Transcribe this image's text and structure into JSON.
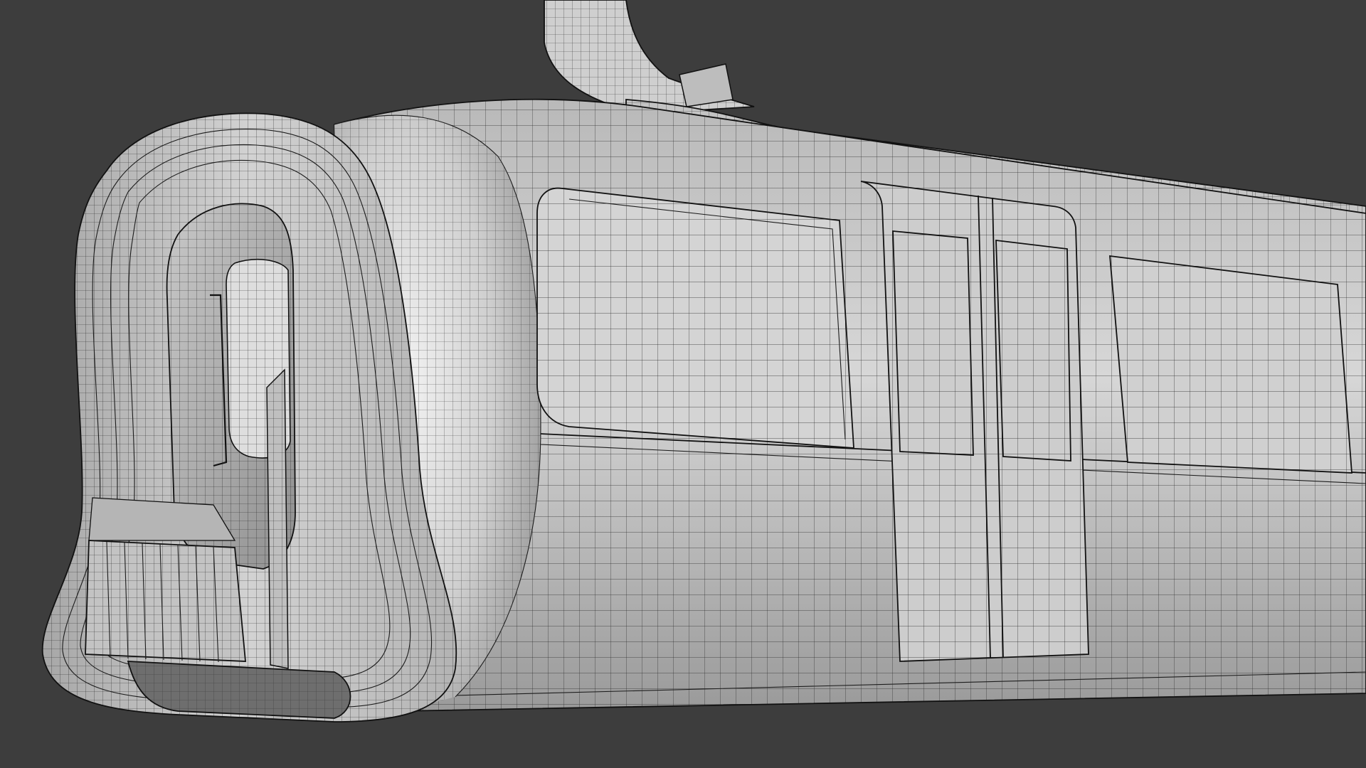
{
  "scene": {
    "background_color": "#3d3d3d",
    "surface_color": "#c9c9c9",
    "surface_highlight": "#e6e6e6",
    "surface_shadow": "#8e8e8e",
    "wire_color": "#1c1c1c",
    "view_mode": "wireframe-on-shaded",
    "subject": "train-carriage-model"
  }
}
